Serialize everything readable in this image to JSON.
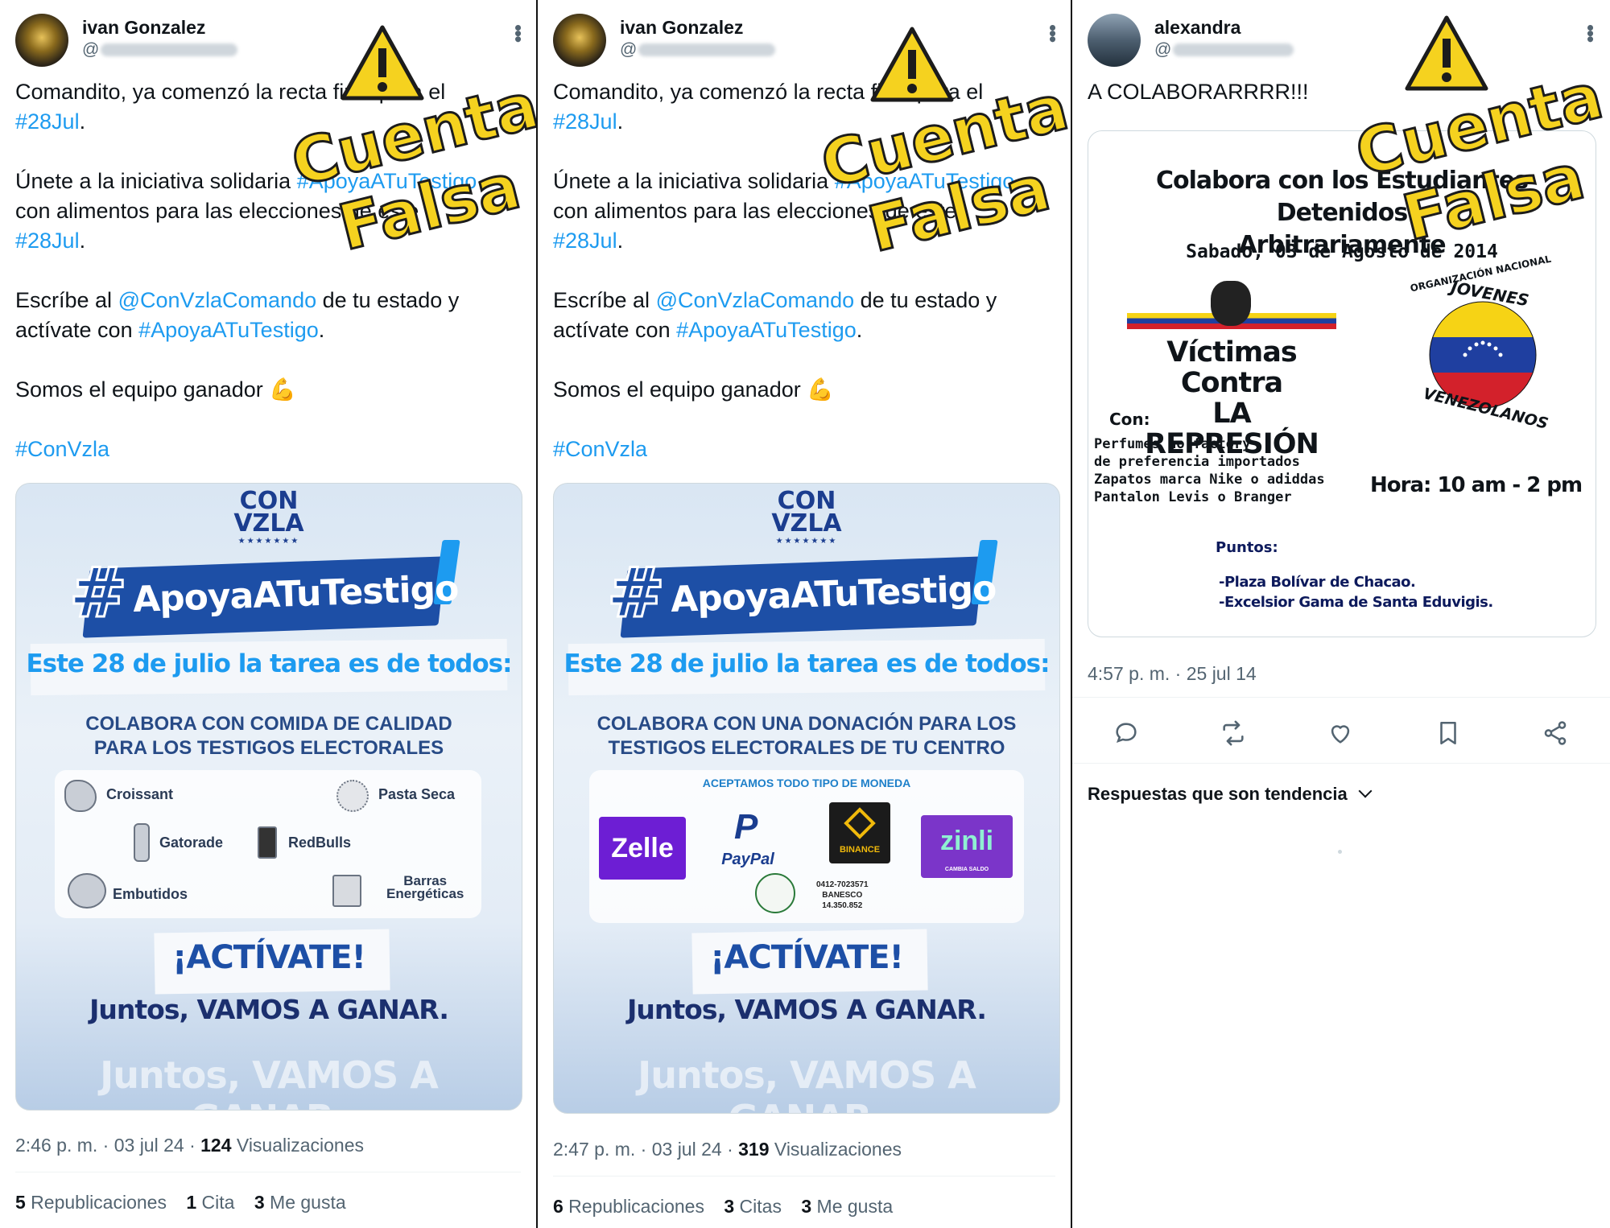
{
  "tweets": [
    {
      "name": "ivan Gonzalez",
      "handle_prefix": "@",
      "lines": {
        "l1": "Comandito, ya comenzó la recta final para el",
        "l2tag": "#28Jul",
        "l3": "Únete a la iniciativa solidaria ",
        "l3tag": "#ApoyaATuTestigo",
        "l4": "con alimentos para las elecciones de este",
        "l5tag": "#28Jul",
        "l6": "Escríbe al ",
        "l6tag": "@ConVzlaComando",
        "l6b": " de tu estado y",
        "l7": "actívate con ",
        "l7tag": "#ApoyaATuTestigo",
        "l8": "Somos el equipo ganador 💪",
        "l9tag": "#ConVzla"
      },
      "poster": {
        "logo_top": "CON",
        "logo_bottom": "VZLA",
        "stars": "★★★★★★★",
        "hash": "#",
        "banner": "ApoyaATuTestigo",
        "date": "Este 28 de julio la tarea es de todos:",
        "sub1": "COLABORA CON COMIDA DE CALIDAD",
        "sub2": "PARA LOS TESTIGOS ELECTORALES",
        "items": [
          "Croissant",
          "Pasta Seca",
          "Gatorade",
          "RedBulls",
          "Embutidos",
          "Barras",
          "Energéticas"
        ],
        "activate": "¡ACTÍVATE!",
        "vamos": "Juntos, VAMOS A GANAR.",
        "ghost": "Juntos, VAMOS A GANAR."
      },
      "time": "2:46 p. m. · 03 jul 24 · ",
      "views": "124",
      "views_label": " Visualizaciones",
      "reposts": "5",
      "reposts_label": " Republicaciones",
      "quotes": "1",
      "quotes_label": " Cita",
      "likes": "3",
      "likes_label": " Me gusta"
    },
    {
      "name": "ivan Gonzalez",
      "handle_prefix": "@",
      "lines": {
        "l1": "Comandito, ya comenzó la recta final para el",
        "l2tag": "#28Jul",
        "l3": "Únete a la iniciativa solidaria ",
        "l3tag": "#ApoyaATuTestigo",
        "l4": "con alimentos para las elecciones de este",
        "l5tag": "#28Jul",
        "l6": "Escríbe al ",
        "l6tag": "@ConVzlaComando",
        "l6b": " de tu estado y",
        "l7": "actívate con ",
        "l7tag": "#ApoyaATuTestigo",
        "l8": "Somos el equipo ganador 💪",
        "l9tag": "#ConVzla"
      },
      "poster": {
        "logo_top": "CON",
        "logo_bottom": "VZLA",
        "stars": "★★★★★★★",
        "hash": "#",
        "banner": "ApoyaATuTestigo",
        "date": "Este 28 de julio la tarea es de todos:",
        "sub1": "COLABORA CON UNA DONACIÓN PARA LOS",
        "sub2": "TESTIGOS ELECTORALES DE TU CENTRO",
        "accept": "ACEPTAMOS TODO TIPO DE MONEDA",
        "pay": [
          "Zelle",
          "PayPal",
          "BINANCE",
          "zinli"
        ],
        "zinli_sub": "CAMBIA SALDO",
        "bank1": "0412-7023571",
        "bank2": "BANESCO",
        "bank3": "14.350.852",
        "activate": "¡ACTÍVATE!",
        "vamos": "Juntos, VAMOS A GANAR.",
        "ghost": "Juntos, VAMOS A GANAR."
      },
      "time": "2:47 p. m. · 03 jul 24 · ",
      "views": "319",
      "views_label": " Visualizaciones",
      "reposts": "6",
      "reposts_label": " Republicaciones",
      "quotes": "3",
      "quotes_label": " Citas",
      "likes": "3",
      "likes_label": " Me gusta"
    },
    {
      "name": "alexandra",
      "handle_prefix": "@",
      "text": "A COLABORARRRR!!!",
      "flyer": {
        "title1": "Colabora con los Estudiantes Detenidos",
        "title2": "Arbitrariamente",
        "date": "Sabado, 03 de Agosto de 2014",
        "victimas1": "Víctimas Contra",
        "victimas2": "LA REPRESIÓN",
        "org_top": "ORGANIZACIÓN NACIONAL",
        "org_mid": "JOVENES",
        "org_bottom": "VENEZOLANOS",
        "con": "Con:",
        "list": [
          "Perfumes no factory",
          "de preferencia importados",
          "Zapatos marca Nike o adiddas",
          "Pantalon Levis o Branger"
        ],
        "hora": "Hora: 10 am - 2 pm",
        "puntos": "Puntos:",
        "p1": "-Plaza Bolívar de Chacao.",
        "p2": "-Excelsior Gama de Santa Eduvigis."
      },
      "time": "4:57 p. m. · 25 jul 14",
      "trending": "Respuestas que son tendencia"
    }
  ],
  "watermark": {
    "line1": "Cuenta",
    "line2": "Falsa",
    "color": "#f5d21f"
  },
  "icons": [
    "reply-icon",
    "repost-icon",
    "like-icon",
    "bookmark-icon",
    "share-icon",
    "more-icon",
    "chevron-down-icon",
    "warning-icon"
  ],
  "colors": {
    "link": "#1d9bf0",
    "muted": "#536471",
    "text": "#0f1419"
  }
}
